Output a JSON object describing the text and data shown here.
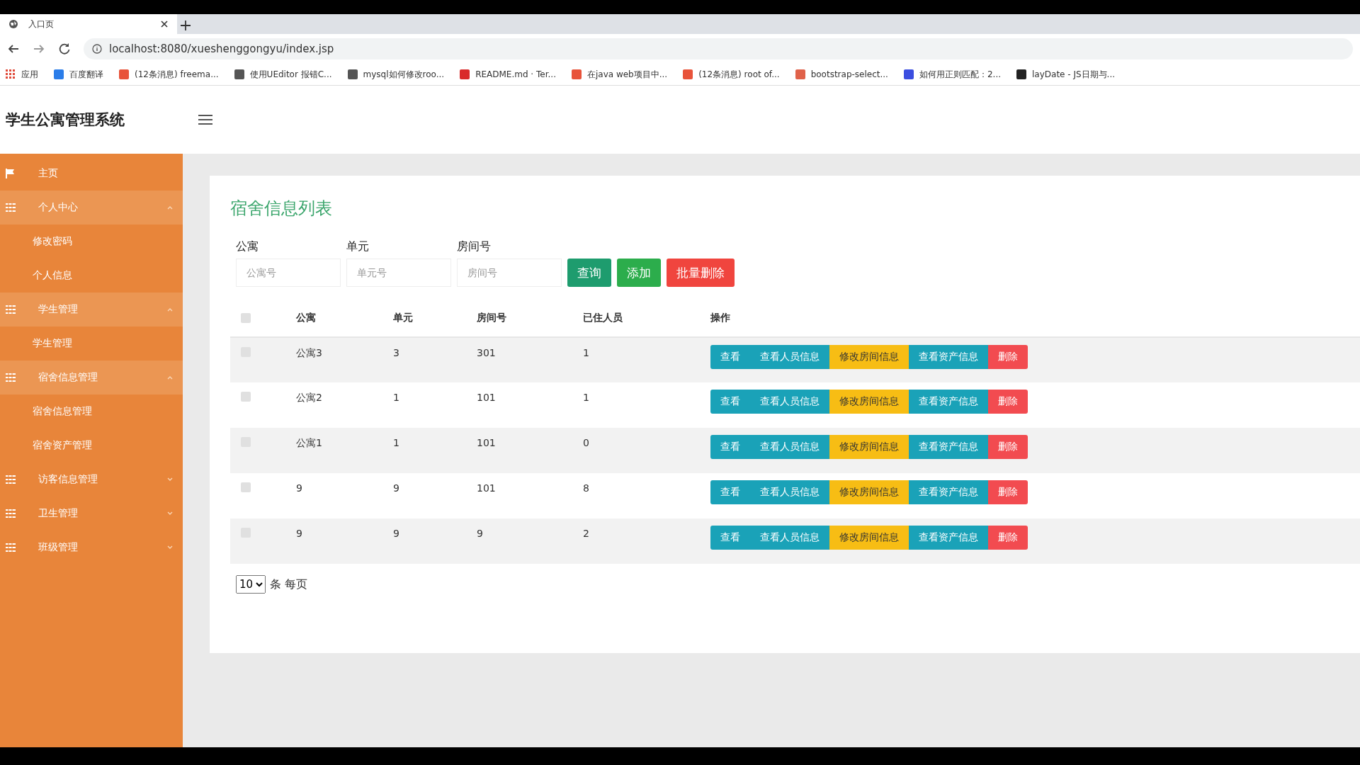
{
  "browser": {
    "tab_title": "入口页",
    "url": "localhost:8080/xueshenggongyu/index.jsp",
    "bookmarks": [
      {
        "label": "应用",
        "color": "#e04a3a"
      },
      {
        "label": "百度翻译",
        "color": "#2b7de9"
      },
      {
        "label": "(12条消息) freema...",
        "color": "#e8533a"
      },
      {
        "label": "使用UEditor 报错C...",
        "color": "#555555"
      },
      {
        "label": "mysql如何修改roo...",
        "color": "#555555"
      },
      {
        "label": "README.md · Ter...",
        "color": "#d92b2b"
      },
      {
        "label": "在java web项目中...",
        "color": "#e8533a"
      },
      {
        "label": "(12条消息) root of...",
        "color": "#e8533a"
      },
      {
        "label": "bootstrap-select...",
        "color": "#e0624a"
      },
      {
        "label": "如何用正则匹配：2...",
        "color": "#3b4ee0"
      },
      {
        "label": "layDate - JS日期与...",
        "color": "#222222"
      }
    ]
  },
  "app": {
    "title": "学生公寓管理系统"
  },
  "sidebar": {
    "items": [
      {
        "label": "主页",
        "kind": "link"
      },
      {
        "label": "个人中心",
        "kind": "group",
        "expanded": true,
        "children": [
          {
            "label": "修改密码"
          },
          {
            "label": "个人信息"
          }
        ]
      },
      {
        "label": "学生管理",
        "kind": "group",
        "expanded": true,
        "children": [
          {
            "label": "学生管理"
          }
        ]
      },
      {
        "label": "宿舍信息管理",
        "kind": "group",
        "expanded": true,
        "children": [
          {
            "label": "宿舍信息管理"
          },
          {
            "label": "宿舍资产管理"
          }
        ]
      },
      {
        "label": "访客信息管理",
        "kind": "group",
        "expanded": false
      },
      {
        "label": "卫生管理",
        "kind": "group",
        "expanded": false
      },
      {
        "label": "班级管理",
        "kind": "group",
        "expanded": false
      }
    ]
  },
  "page": {
    "heading": "宿舍信息列表",
    "filters": [
      {
        "label": "公寓",
        "placeholder": "公寓号"
      },
      {
        "label": "单元",
        "placeholder": "单元号"
      },
      {
        "label": "房间号",
        "placeholder": "房间号"
      }
    ],
    "buttons": [
      {
        "label": "查询",
        "kind": "search"
      },
      {
        "label": "添加",
        "kind": "add"
      },
      {
        "label": "批量删除",
        "kind": "delete"
      }
    ],
    "table": {
      "select_all_checked": false,
      "columns": [
        "公寓",
        "单元",
        "房间号",
        "已住人员",
        "操作"
      ],
      "rows": [
        {
          "checked": false,
          "cells": [
            "公寓3",
            "3",
            "301",
            "1"
          ],
          "actions": [
            {
              "label": "查看",
              "kind": "info"
            },
            {
              "label": "查看人员信息",
              "kind": "info"
            },
            {
              "label": "修改房间信息",
              "kind": "warning"
            },
            {
              "label": "查看资产信息",
              "kind": "info"
            },
            {
              "label": "删除",
              "kind": "danger"
            }
          ]
        },
        {
          "checked": false,
          "cells": [
            "公寓2",
            "1",
            "101",
            "1"
          ],
          "actions": [
            {
              "label": "查看",
              "kind": "info"
            },
            {
              "label": "查看人员信息",
              "kind": "info"
            },
            {
              "label": "修改房间信息",
              "kind": "warning"
            },
            {
              "label": "查看资产信息",
              "kind": "info"
            },
            {
              "label": "删除",
              "kind": "danger"
            }
          ]
        },
        {
          "checked": false,
          "cells": [
            "公寓1",
            "1",
            "101",
            "0"
          ],
          "actions": [
            {
              "label": "查看",
              "kind": "info"
            },
            {
              "label": "查看人员信息",
              "kind": "info"
            },
            {
              "label": "修改房间信息",
              "kind": "warning"
            },
            {
              "label": "查看资产信息",
              "kind": "info"
            },
            {
              "label": "删除",
              "kind": "danger"
            }
          ]
        },
        {
          "checked": false,
          "cells": [
            "9",
            "9",
            "101",
            "8"
          ],
          "actions": [
            {
              "label": "查看",
              "kind": "info"
            },
            {
              "label": "查看人员信息",
              "kind": "info"
            },
            {
              "label": "修改房间信息",
              "kind": "warning"
            },
            {
              "label": "查看资产信息",
              "kind": "info"
            },
            {
              "label": "删除",
              "kind": "danger"
            }
          ]
        },
        {
          "checked": false,
          "cells": [
            "9",
            "9",
            "9",
            "2"
          ],
          "actions": [
            {
              "label": "查看",
              "kind": "info"
            },
            {
              "label": "查看人员信息",
              "kind": "info"
            },
            {
              "label": "修改房间信息",
              "kind": "warning"
            },
            {
              "label": "查看资产信息",
              "kind": "info"
            },
            {
              "label": "删除",
              "kind": "danger"
            }
          ]
        }
      ]
    },
    "pagination": {
      "page_size": "10",
      "suffix": "条 每页"
    }
  }
}
